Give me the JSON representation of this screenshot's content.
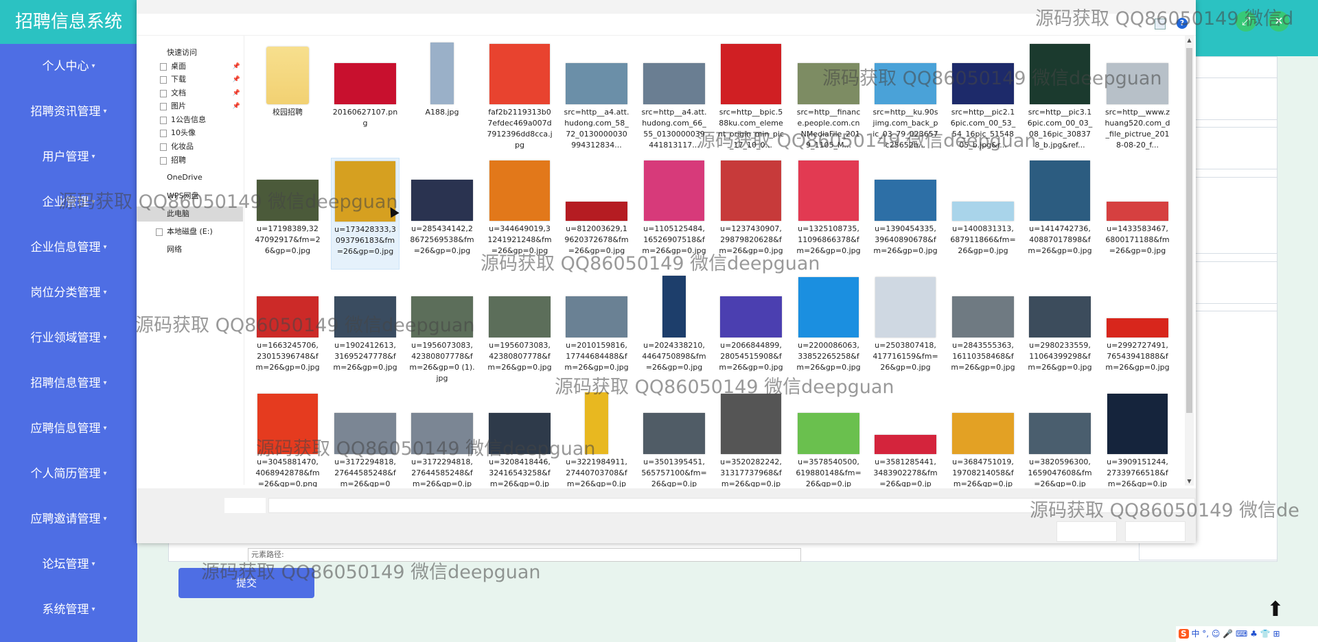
{
  "app": {
    "title": "招聘信息系统",
    "menu": [
      {
        "label": "个人中心"
      },
      {
        "label": "招聘资讯管理"
      },
      {
        "label": "用户管理"
      },
      {
        "label": "企业管理"
      },
      {
        "label": "企业信息管理"
      },
      {
        "label": "岗位分类管理"
      },
      {
        "label": "行业领域管理"
      },
      {
        "label": "招聘信息管理"
      },
      {
        "label": "应聘信息管理"
      },
      {
        "label": "个人简历管理"
      },
      {
        "label": "应聘邀请管理"
      },
      {
        "label": "论坛管理"
      },
      {
        "label": "系统管理"
      }
    ],
    "submit_label": "提交",
    "path_placeholder": "元素路径:",
    "scroll_top_icon": "arrow-up-icon",
    "ime_label": "中 °, ☺ 🎤 ⌨ ♣ 👕 ⊞"
  },
  "dialog": {
    "nav": [
      {
        "label": "快速访问",
        "type": "header"
      },
      {
        "label": "桌面",
        "type": "folder",
        "pinned": true
      },
      {
        "label": "下载",
        "type": "folder",
        "pinned": true
      },
      {
        "label": "文档",
        "type": "folder",
        "pinned": true
      },
      {
        "label": "图片",
        "type": "folder",
        "pinned": true
      },
      {
        "label": "1公告信息",
        "type": "folder"
      },
      {
        "label": "10头像",
        "type": "folder"
      },
      {
        "label": "化妆品",
        "type": "folder"
      },
      {
        "label": "招聘",
        "type": "folder"
      },
      {
        "label": "OneDrive",
        "type": "cloud"
      },
      {
        "label": "WPS网盘",
        "type": "cloud"
      },
      {
        "label": "此电脑",
        "type": "pc",
        "selected": true
      },
      {
        "label": "本地磁盘 (E:)",
        "type": "drive"
      },
      {
        "label": "网络",
        "type": "network"
      }
    ],
    "files": [
      {
        "name": "校园招聘",
        "thumb": "folder",
        "color": "#f2d172"
      },
      {
        "name": "20160627107.png",
        "thumb": "image",
        "color": "#c8102e"
      },
      {
        "name": "A188.jpg",
        "thumb": "tall",
        "color": "#9ab0c8"
      },
      {
        "name": "faf2b2119313b07efdec469a007d7912396dd8cca.jpg",
        "thumb": "logo",
        "color": "#e8432f"
      },
      {
        "name": "src=http__a4.att.hudong.com_58_72_0130000030994312834...",
        "thumb": "image",
        "color": "#6b8fa8"
      },
      {
        "name": "src=http__a4.att.hudong.com_66_55_0130000039441813117...",
        "thumb": "image",
        "color": "#6a7e92"
      },
      {
        "name": "src=http__bpic.588ku.com_element_origin_min_pic_17_10_0...",
        "thumb": "square",
        "color": "#d01f23"
      },
      {
        "name": "src=http__finance.people.com.cn_NMediaFile_2019_1105_M...",
        "thumb": "image",
        "color": "#7d8c63"
      },
      {
        "name": "src=http__ku.90sjimg.com_back_pic_03_79_023657c25652b...",
        "thumb": "image",
        "color": "#4aa2d8"
      },
      {
        "name": "src=http__pic2.16pic.com_00_53_54_16pic_5154805_b.jpg&r...",
        "thumb": "image",
        "color": "#1d2a6a"
      },
      {
        "name": "src=http__pic3.16pic.com_00_03_08_16pic_308378_b.jpg&ref...",
        "thumb": "square",
        "color": "#1b3a2e"
      },
      {
        "name": "src=http__www.zhuang520.com_d_file_pictrue_2018-08-20_f...",
        "thumb": "image",
        "color": "#b7c0c8"
      },
      {
        "name": "u=17198389,3247092917&fm=26&gp=0.jpg",
        "thumb": "image",
        "color": "#4b5a3a"
      },
      {
        "name": "u=173428333,3093796183&fm=26&gp=0.jpg",
        "thumb": "square",
        "color": "#d6a020"
      },
      {
        "name": "u=285434142,28672569538&fm=26&gp=0.jpg",
        "thumb": "image",
        "color": "#2a3350"
      },
      {
        "name": "u=344649019,31241921248&fm=26&gp=0.jpg",
        "thumb": "square",
        "color": "#e2781a"
      },
      {
        "name": "u=812003629,19620372678&fm=26&gp=0.jpg",
        "thumb": "wide",
        "color": "#b51c22"
      },
      {
        "name": "u=1105125484,16526907518&fm=26&gp=0.jpg",
        "thumb": "square",
        "color": "#d73a7a"
      },
      {
        "name": "u=1237430907,29879820628&fm=26&gp=0.jpg",
        "thumb": "square",
        "color": "#c73a3a"
      },
      {
        "name": "u=1325108735,11096866378&fm=26&gp=0.jpg",
        "thumb": "square",
        "color": "#e23a52"
      },
      {
        "name": "u=1390454335,39640890678&fm=26&gp=0.jpg",
        "thumb": "image",
        "color": "#2d6fa6"
      },
      {
        "name": "u=1400831313,687911866&fm=26&gp=0.jpg",
        "thumb": "wide",
        "color": "#a9d4ea"
      },
      {
        "name": "u=1414742736,40887017898&fm=26&gp=0.jpg",
        "thumb": "square",
        "color": "#2c5c80"
      },
      {
        "name": "u=1433583467,6800171188&fm=26&gp=0.jpg",
        "thumb": "wide",
        "color": "#d64040"
      },
      {
        "name": "u=1663245706,23015396748&fm=26&gp=0.jpg",
        "thumb": "image",
        "color": "#cc2a28"
      },
      {
        "name": "u=1902412613,31695247778&fm=26&gp=0.jpg",
        "thumb": "image",
        "color": "#3a4c60"
      },
      {
        "name": "u=1956073083,42380807778&fm=26&gp=0 (1).jpg",
        "thumb": "image",
        "color": "#5c6e5a"
      },
      {
        "name": "u=1956073083,42380807778&fm=26&gp=0.jpg",
        "thumb": "image",
        "color": "#5c6e5a"
      },
      {
        "name": "u=2010159816,17744684488&fm=26&gp=0.jpg",
        "thumb": "image",
        "color": "#6a8194"
      },
      {
        "name": "u=2024338210,4464750898&fm=26&gp=0.jpg",
        "thumb": "tall",
        "color": "#1d3e6b"
      },
      {
        "name": "u=2066844899,28054515908&fm=26&gp=0.jpg",
        "thumb": "image",
        "color": "#4b3fb0"
      },
      {
        "name": "u=2200086063,33852265258&fm=26&gp=0.jpg",
        "thumb": "square",
        "color": "#1b8fe0"
      },
      {
        "name": "u=2503807418,417716159&fm=26&gp=0.jpg",
        "thumb": "square",
        "color": "#cfd8e2"
      },
      {
        "name": "u=2843555363,16110358468&fm=26&gp=0.jpg",
        "thumb": "image",
        "color": "#6f7a82"
      },
      {
        "name": "u=2980233559,11064399298&fm=26&gp=0.jpg",
        "thumb": "image",
        "color": "#3c4c5c"
      },
      {
        "name": "u=2992727491,76543941888&fm=26&gp=0.jpg",
        "thumb": "wide",
        "color": "#d8261c"
      },
      {
        "name": "u=3045881470,4068942878&fm=26&gp=0.png",
        "thumb": "square",
        "color": "#e53b1f"
      },
      {
        "name": "u=3172294818,27644585248&fm=26&gp=0",
        "thumb": "image",
        "color": "#7b8694"
      },
      {
        "name": "u=3172294818,27644585248&fm=26&gp=0.jp",
        "thumb": "image",
        "color": "#7b8694"
      },
      {
        "name": "u=3208418446,32416543258&fm=26&gp=0.jp",
        "thumb": "image",
        "color": "#2e3a4a"
      },
      {
        "name": "u=3221984911,27440703708&fm=26&gp=0.jp",
        "thumb": "tall",
        "color": "#e8b820"
      },
      {
        "name": "u=3501395451,565757100&fm=26&gp=0.jp",
        "thumb": "image",
        "color": "#505c66"
      },
      {
        "name": "u=3520282242,31317737968&fm=26&gp=0.jp",
        "thumb": "square",
        "color": "#555"
      },
      {
        "name": "u=3578540500,619880148&fm=26&gp=0.jp",
        "thumb": "image",
        "color": "#6ac04e"
      },
      {
        "name": "u=3581285441,3483902278&fm=26&gp=0.jp",
        "thumb": "wide",
        "color": "#d4243c"
      },
      {
        "name": "u=3684751019,19708214058&fm=26&gp=0.jp",
        "thumb": "image",
        "color": "#e3a124"
      },
      {
        "name": "u=3820596300,1659047608&fm=26&gp=0.jp",
        "thumb": "image",
        "color": "#4a5e6e"
      },
      {
        "name": "u=3909151244,27339766518&fm=26&gp=0.jp",
        "thumb": "square",
        "color": "#15243c"
      }
    ]
  },
  "watermarks": [
    "源码获取 QQ86050149 微信d",
    "源码获取 QQ86050149 微信deepguan",
    "源码获取 QQ86050149 微信deepguan",
    "源码获取 QQ86050149 微信deepguan",
    "源码获取 QQ86050149 微信deepguan",
    "源码获取 QQ86050149 微信deepguan",
    "源码获取 QQ86050149 微信deepguan",
    "源码获取 QQ86050149 微信deepguan",
    "源码获取 QQ86050149 微信de",
    "源码获取 QQ86050149 微信deepguan"
  ]
}
